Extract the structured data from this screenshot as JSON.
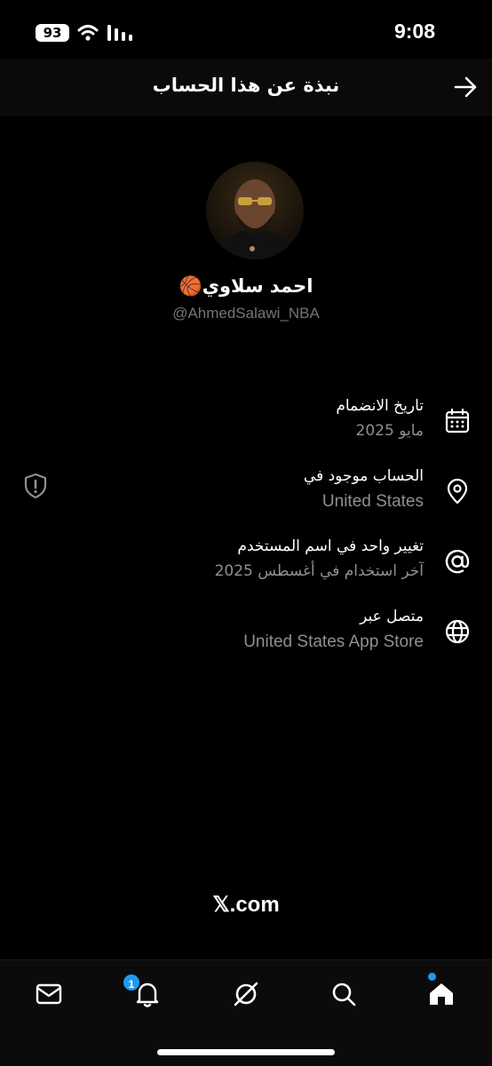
{
  "status_bar": {
    "battery": "93",
    "time": "9:08"
  },
  "header": {
    "title": "نبذة عن هذا الحساب"
  },
  "profile": {
    "display_name": "احمد سلاوي🏀",
    "handle": "@AhmedSalawi_NBA"
  },
  "info": [
    {
      "label": "تاريخ الانضمام",
      "value": "مايو 2025",
      "icon": "calendar-icon"
    },
    {
      "label": "الحساب موجود في",
      "value": "United States",
      "icon": "location-pin-icon"
    },
    {
      "label": "تغيير واحد في اسم المستخدم",
      "value": "آخر استخدام في أغسطس 2025",
      "icon": "at-sign-icon"
    },
    {
      "label": "متصل عبر",
      "value": "United States App Store",
      "icon": "globe-icon"
    }
  ],
  "footer": {
    "brand": "𝕏.com"
  },
  "tab_bar": {
    "notification_count": "1"
  },
  "colors": {
    "background": "#000000",
    "accent": "#1d9bf0",
    "secondary_text": "#8b9096"
  }
}
